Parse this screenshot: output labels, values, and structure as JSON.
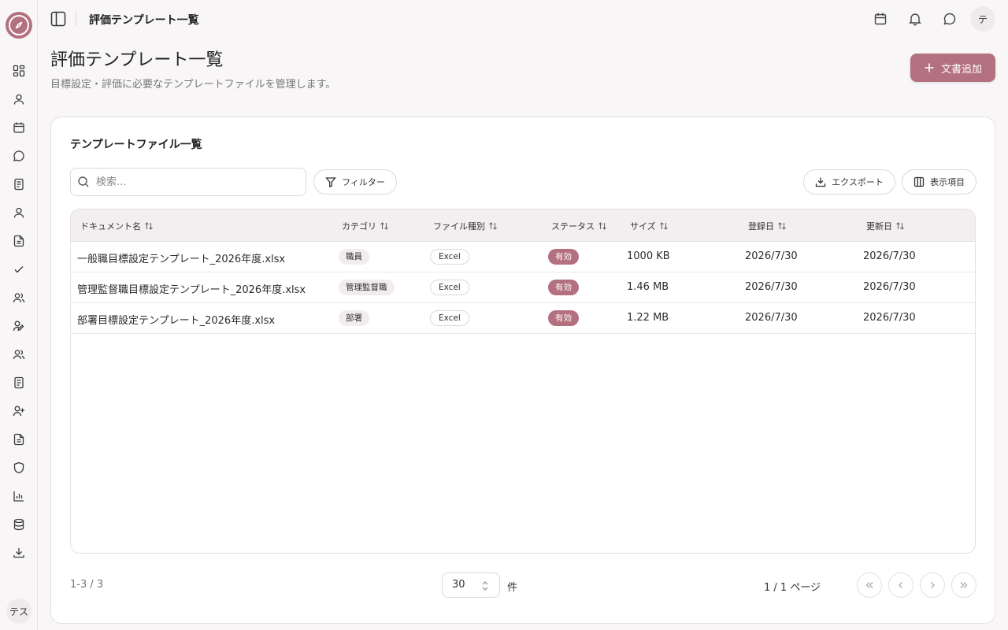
{
  "header": {
    "title": "評価テンプレート一覧",
    "avatar_initial": "テ"
  },
  "sidebar": {
    "items": [
      {
        "icon": "dashboard-icon"
      },
      {
        "icon": "user-icon"
      },
      {
        "icon": "calendar-icon"
      },
      {
        "icon": "chat-icon"
      },
      {
        "icon": "document-icon"
      },
      {
        "icon": "user-icon"
      },
      {
        "icon": "file-text-icon"
      },
      {
        "icon": "check-icon"
      },
      {
        "icon": "users-icon"
      },
      {
        "icon": "user-edit-icon"
      },
      {
        "icon": "users-icon"
      },
      {
        "icon": "document-icon"
      },
      {
        "icon": "user-plus-icon"
      },
      {
        "icon": "file-text-icon"
      },
      {
        "icon": "shield-icon"
      },
      {
        "icon": "bar-chart-icon"
      },
      {
        "icon": "database-icon"
      },
      {
        "icon": "download-icon"
      }
    ],
    "user_label": "テス"
  },
  "page": {
    "title": "評価テンプレート一覧",
    "subtitle": "目標設定・評価に必要なテンプレートファイルを管理します。",
    "add_button_label": "文書追加"
  },
  "card": {
    "title": "テンプレートファイル一覧",
    "search_placeholder": "検索...",
    "filter_label": "フィルター",
    "export_label": "エクスポート",
    "columns_label": "表示項目"
  },
  "table": {
    "headers": [
      "ドキュメント名",
      "カテゴリ",
      "ファイル種別",
      "ステータス",
      "サイズ",
      "登録日",
      "更新日"
    ],
    "rows": [
      {
        "name": "一般職目標設定テンプレート_2026年度.xlsx",
        "category": "職員",
        "type": "Excel",
        "status": "有効",
        "size": "1000 KB",
        "created": "2026/7/30",
        "updated": "2026/7/30"
      },
      {
        "name": "管理監督職目標設定テンプレート_2026年度.xlsx",
        "category": "管理監督職",
        "type": "Excel",
        "status": "有効",
        "size": "1.46 MB",
        "created": "2026/7/30",
        "updated": "2026/7/30"
      },
      {
        "name": "部署目標設定テンプレート_2026年度.xlsx",
        "category": "部署",
        "type": "Excel",
        "status": "有効",
        "size": "1.22 MB",
        "created": "2026/7/30",
        "updated": "2026/7/30"
      }
    ]
  },
  "pagination": {
    "count_text": "1-3 / 3",
    "page_size": "30",
    "unit": "件",
    "page_info": "1 / 1 ページ"
  },
  "colors": {
    "accent": "#b3707f",
    "background": "#f8f6f7"
  }
}
